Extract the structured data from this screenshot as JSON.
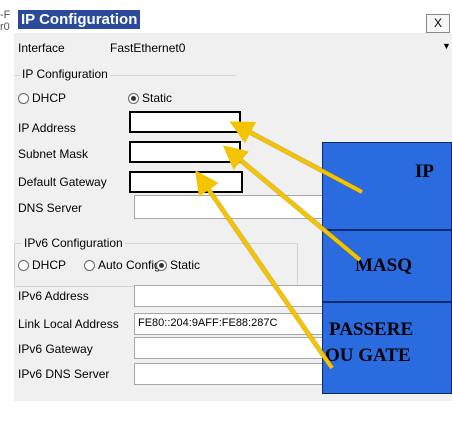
{
  "window": {
    "title": "IP Configuration",
    "close_label": "X"
  },
  "left_fragments": [
    "-F",
    "r0"
  ],
  "interface": {
    "label": "Interface",
    "value": "FastEthernet0"
  },
  "ipv4": {
    "legend": "IP Configuration",
    "dhcp_label": "DHCP",
    "static_label": "Static",
    "selected": "Static",
    "ip_address_label": "IP Address",
    "ip_address_value": "",
    "subnet_mask_label": "Subnet Mask",
    "subnet_mask_value": "",
    "gateway_label": "Default Gateway",
    "gateway_value": "",
    "dns_label": "DNS Server",
    "dns_value": ""
  },
  "ipv6": {
    "legend": "IPv6 Configuration",
    "dhcp_label": "DHCP",
    "auto_label": "Auto Config",
    "static_label": "Static",
    "selected": "Static",
    "address_label": "IPv6 Address",
    "address_value": "",
    "link_local_label": "Link Local Address",
    "link_local_value": "FE80::204:9AFF:FE88:287C",
    "gateway_label": "IPv6 Gateway",
    "gateway_value": "",
    "dns_label": "IPv6 DNS Server",
    "dns_value": ""
  },
  "callouts": {
    "ip": "IP",
    "mask": "MASQ",
    "gateway_line1": "PASSERE",
    "gateway_line2": "OU GATE"
  },
  "colors": {
    "callout_fill": "#2a6be0",
    "arrow": "#f5c400",
    "title_bg": "#2b4b9a"
  }
}
